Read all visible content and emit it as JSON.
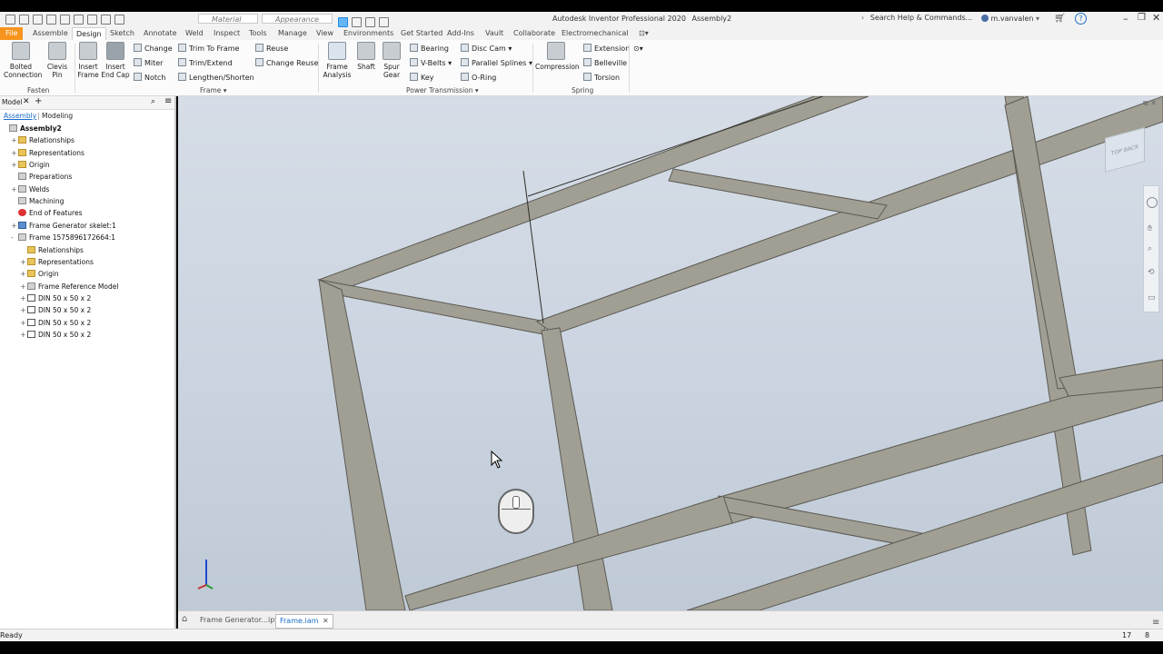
{
  "titlebar": {
    "material_placeholder": "Material",
    "appearance_placeholder": "Appearance",
    "app_title": "Autodesk Inventor Professional 2020",
    "document_title": "Assembly2",
    "search_placeholder": "Search Help & Commands...",
    "user": "m.vanvalen"
  },
  "ribbon_tabs": [
    {
      "label": "File"
    },
    {
      "label": "Assemble"
    },
    {
      "label": "Design"
    },
    {
      "label": "Sketch"
    },
    {
      "label": "Annotate"
    },
    {
      "label": "Weld"
    },
    {
      "label": "Inspect"
    },
    {
      "label": "Tools"
    },
    {
      "label": "Manage"
    },
    {
      "label": "View"
    },
    {
      "label": "Environments"
    },
    {
      "label": "Get Started"
    },
    {
      "label": "Add-Ins"
    },
    {
      "label": "Vault"
    },
    {
      "label": "Collaborate"
    },
    {
      "label": "Electromechanical"
    }
  ],
  "ribbon": {
    "fasten": {
      "panel_label": "Fasten",
      "bolted_connection": [
        "Bolted",
        "Connection"
      ],
      "clevis_pin": [
        "Clevis",
        "Pin"
      ]
    },
    "frame": {
      "panel_label": "Frame",
      "insert_frame": [
        "Insert",
        "Frame"
      ],
      "insert_end_cap": [
        "Insert",
        "End Cap"
      ],
      "change": "Change",
      "miter": "Miter",
      "notch": "Notch",
      "trim_to_frame": "Trim To Frame",
      "trim_extend": "Trim/Extend",
      "lengthen_shorten": "Lengthen/Shorten",
      "reuse": "Reuse",
      "change_reuse": "Change Reuse"
    },
    "power_transmission": {
      "panel_label": "Power Transmission",
      "frame_analysis": [
        "Frame",
        "Analysis"
      ],
      "shaft": "Shaft",
      "spur_gear": [
        "Spur",
        "Gear"
      ],
      "bearing": "Bearing",
      "v_belts": "V-Belts",
      "key": "Key",
      "disc_cam": "Disc Cam",
      "parallel_splines": "Parallel Splines",
      "o_ring": "O-Ring"
    },
    "spring": {
      "panel_label": "Spring",
      "compression": "Compression",
      "extension": "Extension",
      "belleville": "Belleville",
      "torsion": "Torsion"
    }
  },
  "browser": {
    "title": "Model",
    "tabs": [
      "Assembly",
      "Modeling"
    ],
    "nodes": [
      {
        "label": "Assembly2",
        "icon": "assembly-icon",
        "level": 0,
        "exp": ""
      },
      {
        "label": "Relationships",
        "icon": "folder-icon",
        "level": 1,
        "exp": "+"
      },
      {
        "label": "Representations",
        "icon": "folder-icon",
        "level": 1,
        "exp": "+"
      },
      {
        "label": "Origin",
        "icon": "folder-icon",
        "level": 1,
        "exp": "+"
      },
      {
        "label": "Preparations",
        "icon": "preparations-icon",
        "level": 1,
        "exp": ""
      },
      {
        "label": "Welds",
        "icon": "welds-icon",
        "level": 1,
        "exp": "+"
      },
      {
        "label": "Machining",
        "icon": "machining-icon",
        "level": 1,
        "exp": ""
      },
      {
        "label": "End of Features",
        "icon": "end-of-features-icon",
        "level": 1,
        "exp": ""
      },
      {
        "label": "Frame Generator skelet:1",
        "icon": "part-icon",
        "level": 1,
        "exp": "+"
      },
      {
        "label": "Frame 1575896172664:1",
        "icon": "subassembly-icon",
        "level": 1,
        "exp": "-"
      },
      {
        "label": "Relationships",
        "icon": "folder-icon",
        "level": 2,
        "exp": ""
      },
      {
        "label": "Representations",
        "icon": "folder-icon",
        "level": 2,
        "exp": "+"
      },
      {
        "label": "Origin",
        "icon": "folder-icon",
        "level": 2,
        "exp": "+"
      },
      {
        "label": "Frame Reference Model",
        "icon": "reference-model-icon",
        "level": 2,
        "exp": "+"
      },
      {
        "label": "DIN 50 x 50 x 2",
        "icon": "frame-member-icon",
        "level": 2,
        "exp": "+"
      },
      {
        "label": "DIN 50 x 50 x 2",
        "icon": "frame-member-icon",
        "level": 2,
        "exp": "+"
      },
      {
        "label": "DIN 50 x 50 x 2",
        "icon": "frame-member-icon",
        "level": 2,
        "exp": "+"
      },
      {
        "label": "DIN 50 x 50 x 2",
        "icon": "frame-member-icon",
        "level": 2,
        "exp": "+"
      }
    ]
  },
  "viewcube": {
    "top_label": "TOP",
    "back_label": "BACK"
  },
  "doc_tabs": [
    {
      "label": "Frame Generator...ipt",
      "active": false
    },
    {
      "label": "Frame.iam",
      "active": true
    }
  ],
  "status": {
    "text": "Ready",
    "count_a": "17",
    "count_b": "8"
  }
}
